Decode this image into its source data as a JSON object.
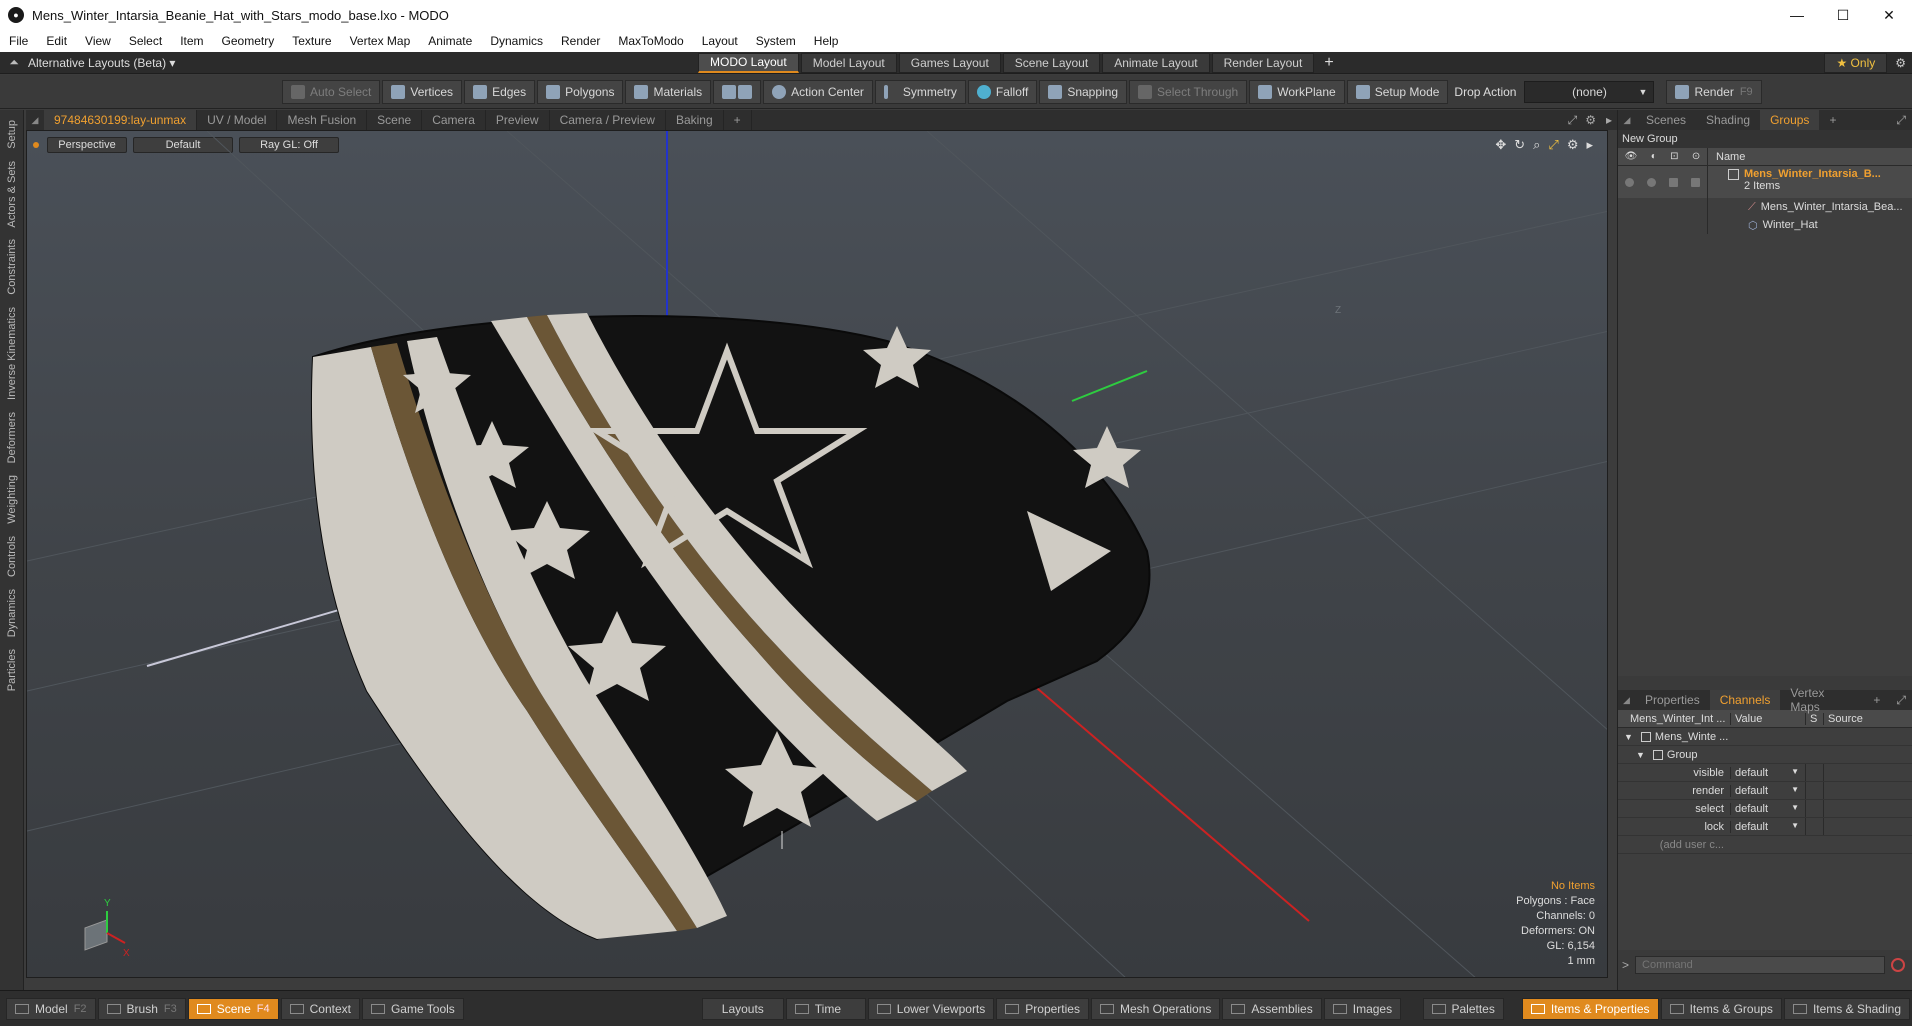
{
  "window": {
    "title": "Mens_Winter_Intarsia_Beanie_Hat_with_Stars_modo_base.lxo - MODO",
    "minimize": "—",
    "maximize": "☐",
    "close": "✕"
  },
  "menu": [
    "File",
    "Edit",
    "View",
    "Select",
    "Item",
    "Geometry",
    "Texture",
    "Vertex Map",
    "Animate",
    "Dynamics",
    "Render",
    "MaxToModo",
    "Layout",
    "System",
    "Help"
  ],
  "layoutbar": {
    "alt_layouts": "Alternative Layouts (Beta) ▾",
    "tabs": [
      "MODO Layout",
      "Model Layout",
      "Games Layout",
      "Scene Layout",
      "Animate Layout",
      "Render Layout"
    ],
    "add": "+",
    "only": "★  Only"
  },
  "toolbar": {
    "auto_select": "Auto Select",
    "vertices": "Vertices",
    "edges": "Edges",
    "polygons": "Polygons",
    "materials": "Materials",
    "action_center": "Action Center",
    "symmetry": "Symmetry",
    "falloff": "Falloff",
    "snapping": "Snapping",
    "select_through": "Select Through",
    "workplane": "WorkPlane",
    "setup_mode": "Setup Mode",
    "drop_action": "Drop Action",
    "drop_value": "(none)",
    "render": "Render",
    "render_key": "F9"
  },
  "left_tabs": [
    "Setup",
    "Actors & Sets",
    "Constraints",
    "Inverse Kinematics",
    "Deformers",
    "Weighting",
    "Controls",
    "Dynamics",
    "Particles"
  ],
  "viewport_tabs": [
    "97484630199:lay-unmax",
    "UV / Model",
    "Mesh Fusion",
    "Scene",
    "Camera",
    "Preview",
    "Camera / Preview",
    "Baking",
    "+"
  ],
  "viewport": {
    "perspective": "Perspective",
    "shading": "Default",
    "raygl": "Ray GL: Off",
    "info": {
      "no_items": "No Items",
      "polygons": "Polygons : Face",
      "channels": "Channels: 0",
      "deformers": "Deformers: ON",
      "gl": "GL: 6,154",
      "unit": "1 mm"
    },
    "axis_y": "Y",
    "axis_x": "X",
    "axis_z": "Z"
  },
  "groups_panel": {
    "tabs": [
      "Scenes",
      "Shading",
      "Groups",
      "+"
    ],
    "new_group": "New Group",
    "name_header": "Name",
    "group_name": "Mens_Winter_Intarsia_B...",
    "group_count": "2 Items",
    "children": [
      "Mens_Winter_Intarsia_Bea...",
      "Winter_Hat"
    ]
  },
  "channels_panel": {
    "tabs": [
      "Properties",
      "Channels",
      "Vertex Maps",
      "+"
    ],
    "headers": {
      "name": "Mens_Winter_Int ...",
      "value": "Value",
      "s": "S",
      "source": "Source"
    },
    "root": "Mens_Winte ...",
    "group": "Group",
    "rows": [
      {
        "name": "visible",
        "value": "default"
      },
      {
        "name": "render",
        "value": "default"
      },
      {
        "name": "select",
        "value": "default"
      },
      {
        "name": "lock",
        "value": "default"
      }
    ],
    "add_user": "(add user c...",
    "command_placeholder": "Command"
  },
  "bottombar": {
    "model": "Model",
    "model_key": "F2",
    "brush": "Brush",
    "brush_key": "F3",
    "scene": "Scene",
    "scene_key": "F4",
    "context": "Context",
    "game_tools": "Game Tools",
    "layouts": "Layouts",
    "time": "Time",
    "lower_viewports": "Lower Viewports",
    "properties": "Properties",
    "mesh_operations": "Mesh Operations",
    "assemblies": "Assemblies",
    "images": "Images",
    "palettes": "Palettes",
    "items_properties": "Items & Properties",
    "items_groups": "Items & Groups",
    "items_shading": "Items & Shading"
  },
  "colors": {
    "accent": "#e08a1e",
    "hat_dark": "#111111",
    "hat_stripe": "#d8d4cc",
    "hat_brown": "#6b5636"
  }
}
